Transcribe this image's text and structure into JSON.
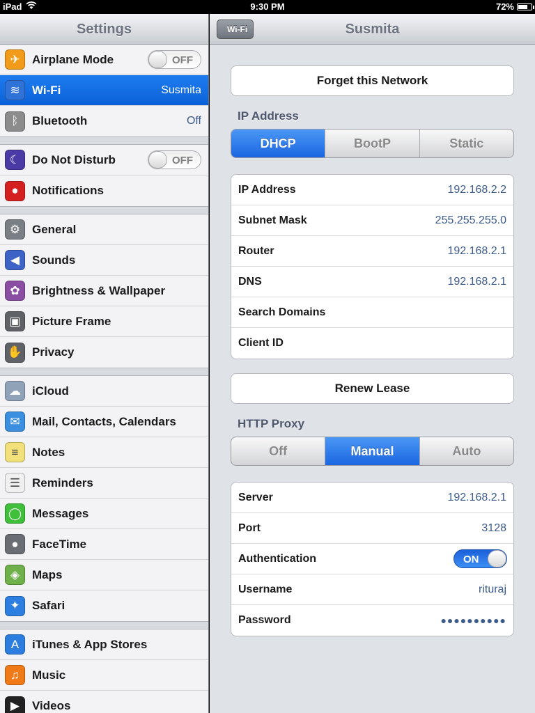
{
  "status": {
    "device": "iPad",
    "time": "9:30 PM",
    "battery": "72%",
    "battery_level": 0.72
  },
  "left_nav": {
    "title": "Settings"
  },
  "groups": [
    [
      {
        "name": "airplane-mode",
        "label": "Airplane Mode",
        "icon": "airplane-icon",
        "color": "#f29a19",
        "toggle": "OFF"
      },
      {
        "name": "wifi",
        "label": "Wi-Fi",
        "icon": "wifi-icon",
        "color": "#2f72d8",
        "value": "Susmita",
        "selected": true
      },
      {
        "name": "bluetooth",
        "label": "Bluetooth",
        "icon": "bluetooth-icon",
        "color": "#8c8c8c",
        "value": "Off"
      }
    ],
    [
      {
        "name": "do-not-disturb",
        "label": "Do Not Disturb",
        "icon": "moon-icon",
        "color": "#4a3aa6",
        "toggle": "OFF"
      },
      {
        "name": "notifications",
        "label": "Notifications",
        "icon": "notifications-icon",
        "color": "#d42020"
      }
    ],
    [
      {
        "name": "general",
        "label": "General",
        "icon": "gear-icon",
        "color": "#7a7e85"
      },
      {
        "name": "sounds",
        "label": "Sounds",
        "icon": "speaker-icon",
        "color": "#3d63c7"
      },
      {
        "name": "brightness-wallpaper",
        "label": "Brightness & Wallpaper",
        "icon": "flower-icon",
        "color": "#8a4fa3"
      },
      {
        "name": "picture-frame",
        "label": "Picture Frame",
        "icon": "picture-frame-icon",
        "color": "#5f6266"
      },
      {
        "name": "privacy",
        "label": "Privacy",
        "icon": "hand-icon",
        "color": "#5f6266"
      }
    ],
    [
      {
        "name": "icloud",
        "label": "iCloud",
        "icon": "cloud-icon",
        "color": "#8fa2b8"
      },
      {
        "name": "mail-contacts-calendars",
        "label": "Mail, Contacts, Calendars",
        "icon": "mail-icon",
        "color": "#3b8fe0"
      },
      {
        "name": "notes",
        "label": "Notes",
        "icon": "notes-icon",
        "color": "#f2e07a"
      },
      {
        "name": "reminders",
        "label": "Reminders",
        "icon": "reminders-icon",
        "color": "#f0f0f0"
      },
      {
        "name": "messages",
        "label": "Messages",
        "icon": "messages-icon",
        "color": "#3fbf3a"
      },
      {
        "name": "facetime",
        "label": "FaceTime",
        "icon": "facetime-icon",
        "color": "#6a6e74"
      },
      {
        "name": "maps",
        "label": "Maps",
        "icon": "maps-icon",
        "color": "#6fb04a"
      },
      {
        "name": "safari",
        "label": "Safari",
        "icon": "safari-icon",
        "color": "#2c7fe0"
      }
    ],
    [
      {
        "name": "itunes-app-stores",
        "label": "iTunes & App Stores",
        "icon": "app-store-icon",
        "color": "#2b7ee0"
      },
      {
        "name": "music",
        "label": "Music",
        "icon": "music-icon",
        "color": "#f07a18"
      },
      {
        "name": "videos",
        "label": "Videos",
        "icon": "videos-icon",
        "color": "#222"
      }
    ]
  ],
  "detail": {
    "back_label": "Wi-Fi",
    "title": "Susmita",
    "forget_label": "Forget this Network",
    "ip_section": "IP Address",
    "ip_modes": [
      "DHCP",
      "BootP",
      "Static"
    ],
    "ip_active": 0,
    "ip_rows": [
      {
        "key": "IP Address",
        "value": "192.168.2.2"
      },
      {
        "key": "Subnet Mask",
        "value": "255.255.255.0"
      },
      {
        "key": "Router",
        "value": "192.168.2.1"
      },
      {
        "key": "DNS",
        "value": "192.168.2.1"
      },
      {
        "key": "Search Domains",
        "value": ""
      },
      {
        "key": "Client ID",
        "value": ""
      }
    ],
    "renew_label": "Renew Lease",
    "proxy_section": "HTTP Proxy",
    "proxy_modes": [
      "Off",
      "Manual",
      "Auto"
    ],
    "proxy_active": 1,
    "proxy_rows": [
      {
        "key": "Server",
        "value": "192.168.2.1"
      },
      {
        "key": "Port",
        "value": "3128"
      },
      {
        "key": "Authentication",
        "toggle": "ON"
      },
      {
        "key": "Username",
        "value": "rituraj"
      },
      {
        "key": "Password",
        "value": "●●●●●●●●●●"
      }
    ]
  }
}
